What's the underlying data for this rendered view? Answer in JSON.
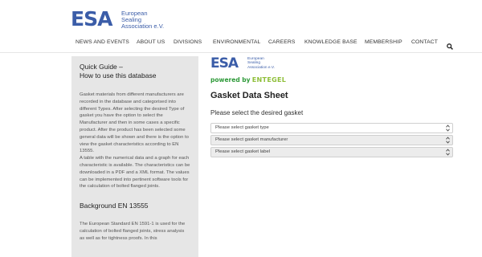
{
  "header": {
    "logo": {
      "letters": "ESA",
      "lines": [
        "European",
        "Sealing",
        "Association e.V."
      ]
    },
    "nav": [
      {
        "label": "NEWS AND EVENTS",
        "name": "nav-news-and-events"
      },
      {
        "label": "ABOUT US",
        "name": "nav-about-us"
      },
      {
        "label": "DIVISIONS",
        "name": "nav-divisions"
      },
      {
        "label": "ENVIRONMENTAL",
        "name": "nav-environmental"
      },
      {
        "label": "CAREERS",
        "name": "nav-careers"
      },
      {
        "label": "KNOWLEDGE BASE",
        "name": "nav-knowledge-base"
      },
      {
        "label": "MEMBERSHIP",
        "name": "nav-membership"
      },
      {
        "label": "CONTACT",
        "name": "nav-contact"
      }
    ],
    "search_icon": "search-icon"
  },
  "sidebar": {
    "quick_guide_title_line1": "Quick Guide –",
    "quick_guide_title_line2": "How to use this database",
    "quick_guide_text": "Gasket materials from different manufacturers are recorded in the database and categorised into different Types. After selecting the desired Type of gasket you have the option to select the Manufacturer and then in some cases a specific product. After the product has been selected some general data will be shown and there is the option to view the gasket characteristics according to EN 13555.",
    "quick_guide_text2": "A table with the numerical data and a graph for each characteristic is available. The characteristics can be downloaded in a PDF and a XML format. The values can be implemented into pertinent software tools for the calculation of bolted flanged joints.",
    "background_title": "Background EN 13555",
    "background_text": "The European Standard EN 1591-1 is used for the calculation of bolted flanged joints, stress analysis as well as for tightness proofs. In this"
  },
  "main": {
    "logo": {
      "letters": "ESA",
      "lines": [
        "European",
        "Sealing",
        "Association e.V."
      ],
      "powered_by": "powered by",
      "brand": "ENTEGEL"
    },
    "title": "Gasket Data Sheet",
    "subtitle": "Please select the desired gasket",
    "selects": [
      {
        "placeholder": "Please select gasket type",
        "name": "gasket-type-select"
      },
      {
        "placeholder": "Please select gasket manufacturer",
        "name": "gasket-manufacturer-select"
      },
      {
        "placeholder": "Please select gasket label",
        "name": "gasket-label-select"
      }
    ]
  },
  "colors": {
    "brand_blue": "#3b5da8",
    "green": "#2f9a3a",
    "lime": "#8fbf3a",
    "sidebar_bg": "#e6e6e6"
  }
}
